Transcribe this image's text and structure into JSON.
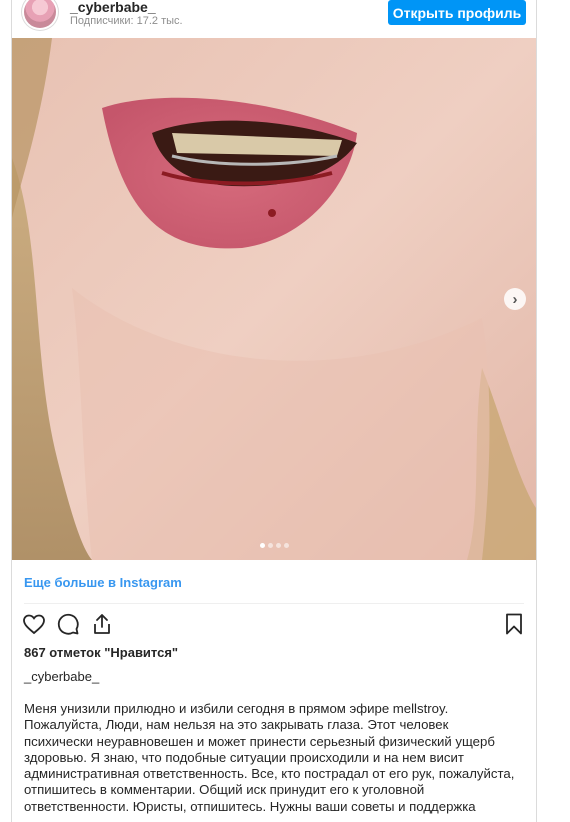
{
  "header": {
    "username": "_cyberbabe_",
    "followers": "Подписчики: 17.2 тыс.",
    "open_profile_label": "Открыть профиль"
  },
  "carousel": {
    "total": 4,
    "current": 1,
    "next_symbol": "›"
  },
  "more_link": "Еще больше в Instagram",
  "actions": {
    "icons": [
      "heart-icon",
      "comment-icon",
      "share-icon",
      "bookmark-icon"
    ]
  },
  "likes": "867 отметок \"Нравится\"",
  "caption": {
    "username": "_cyberbabe_",
    "text": "Меня унизили прилюдно и избили сегодня в прямом эфире mellstroy.\nПожалуйста, Люди, нам нельзя на это закрывать глаза. Этот человек\nпсихически неуравновешен и может принести серьезный физический ущерб\nздоровью. Я знаю, что подобные ситуации происходили и на нем висит\nадминистративная ответственность. Все, кто пострадал от его рук, пожалуйста,\nотпишитесь в комментарии. Общий иск принудит его к уголовной\nответственности. Юристы, отпишитесь. Нужны ваши советы и поддержка"
  },
  "colors": {
    "accent": "#0095f6",
    "link": "#3897f0",
    "text": "#262626",
    "muted": "#8e8e8e"
  }
}
